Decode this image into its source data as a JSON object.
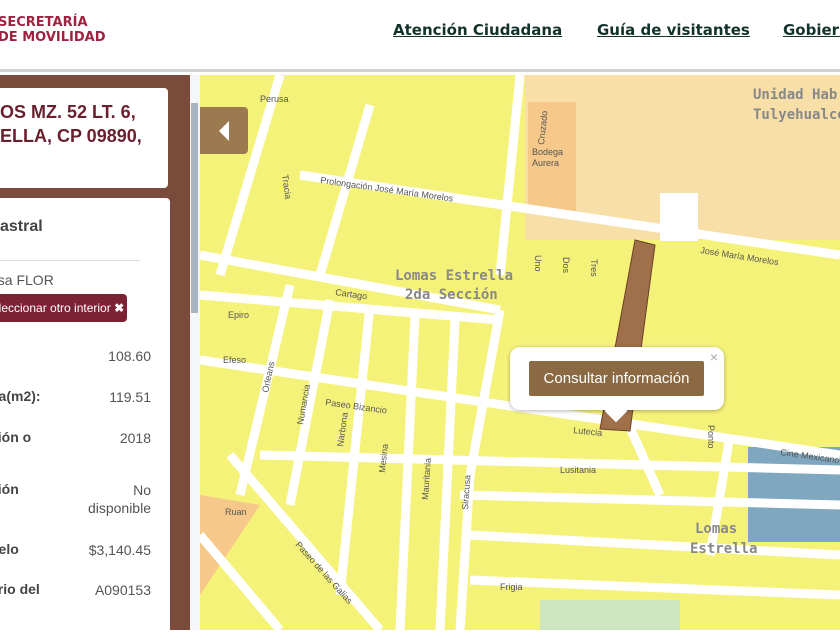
{
  "header": {
    "logo_line1": "SECRETARÍA",
    "logo_line2": "DE MOVILIDAD",
    "nav": [
      "Atención Ciudadana",
      "Guía de visitantes",
      "Gobierno"
    ]
  },
  "address": {
    "line1": "OS MZ. 52 LT. 6,",
    "line2": "ELLA, CP 09890,"
  },
  "card": {
    "title": "astral",
    "interior": "asa FLOR",
    "reselect_label": "eleccionar otro interior",
    "rows": [
      {
        "k": ":",
        "v": "108.60"
      },
      {
        "k": "da(m2):",
        "v": "119.51"
      },
      {
        "k": "ción o",
        "v": "2018"
      },
      {
        "k": "ción",
        "v": "No disponible"
      },
      {
        "k": "uelo",
        "v": "$3,140.45"
      },
      {
        "k": "ario del",
        "v": "A090153"
      }
    ]
  },
  "map": {
    "labels": {
      "l1": "Lomas Estrella",
      "l2": "2da Sección",
      "l3": "Lomas",
      "l4": "Estrella",
      "uh1": "Unidad Hab",
      "uh2": "Tulyehualco",
      "bodega1": "Bodega",
      "bodega2": "Aurera"
    },
    "streets": [
      "Perusa",
      "Cruzado",
      "Prolongación José María Morelos",
      "José María Morelos",
      "Cartago",
      "Epiro",
      "Efeso",
      "Orleans",
      "Numancia",
      "Narbona",
      "Paseo Bizancio",
      "Mesina",
      "Mauritania",
      "Siracusa",
      "Lutecia",
      "Lusitania",
      "Ruan",
      "Paseo de las Galias",
      "Frigia",
      "Cine Mexicano",
      "Tracia",
      "Uno",
      "Dos",
      "Tres",
      "Ponto"
    ]
  },
  "popup": {
    "button": "Consultar información",
    "close": "×"
  }
}
